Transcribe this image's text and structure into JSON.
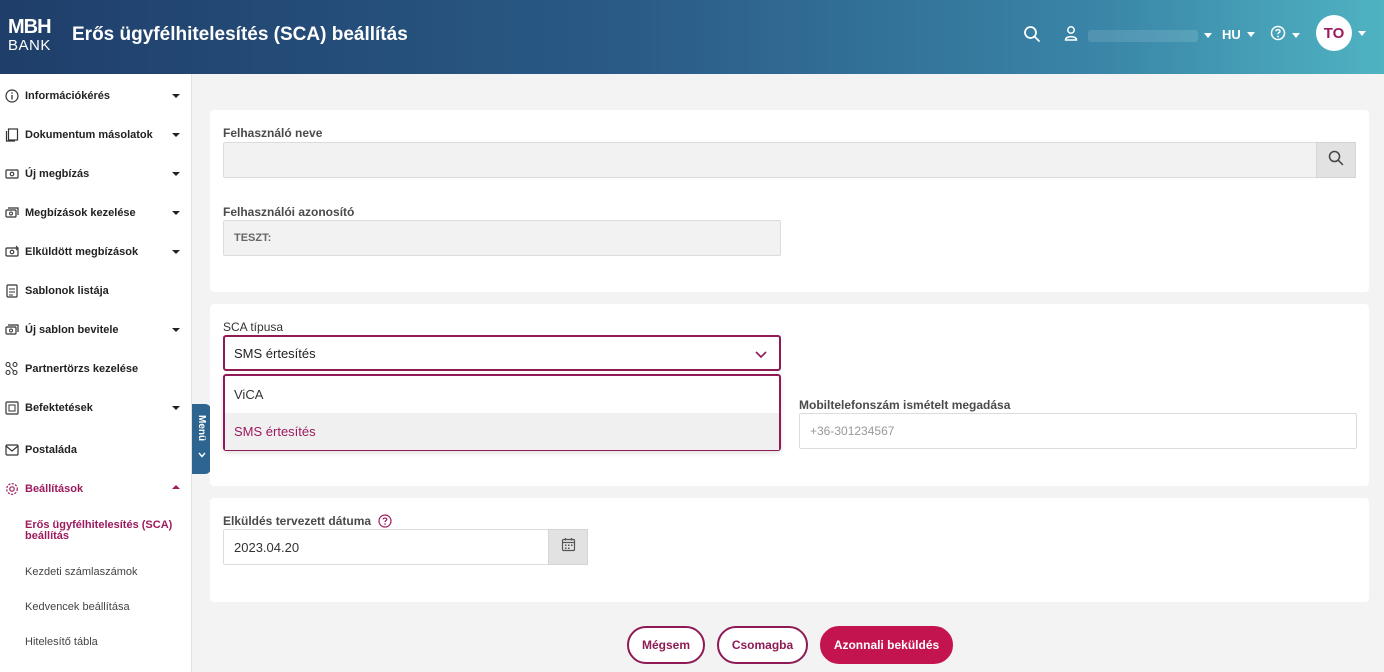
{
  "header": {
    "logo_line1": "MBH",
    "logo_line2": "BANK",
    "title": "Erős ügyfélhitelesítés (SCA) beállítás",
    "language": "HU",
    "avatar_initials": "TO"
  },
  "sidebar": {
    "items": [
      {
        "label": "Információkérés",
        "icon": "info-icon"
      },
      {
        "label": "Dokumentum másolatok",
        "icon": "document-copy-icon"
      },
      {
        "label": "Új megbízás",
        "icon": "new-order-icon"
      },
      {
        "label": "Megbízások kezelése",
        "icon": "manage-orders-icon"
      },
      {
        "label": "Elküldött megbízások",
        "icon": "sent-orders-icon"
      },
      {
        "label": "Sablonok listája",
        "icon": "template-list-icon"
      },
      {
        "label": "Új sablon bevitele",
        "icon": "new-template-icon"
      },
      {
        "label": "Partnertörzs kezelése",
        "icon": "partners-icon"
      },
      {
        "label": "Befektetések",
        "icon": "investments-icon"
      },
      {
        "label": "Postaláda",
        "icon": "mail-icon"
      },
      {
        "label": "Beállítások",
        "icon": "gear-icon"
      }
    ],
    "subitems": [
      {
        "label": "Erős ügyfélhitelesítés (SCA) beállítás"
      },
      {
        "label": "Kezdeti számlaszámok"
      },
      {
        "label": "Kedvencek beállítása"
      },
      {
        "label": "Hitelesítő tábla"
      }
    ],
    "menu_tab_label": "Menü"
  },
  "form": {
    "username_label": "Felhasználó neve",
    "userid_label": "Felhasználói azonosító",
    "userid_value": "TESZT:",
    "sca_label": "SCA típusa",
    "sca_selected": "SMS értesítés",
    "sca_options": [
      "ViCA",
      "SMS értesítés"
    ],
    "mobile_repeat_label": "Mobiltelefonszám ismételt megadása",
    "mobile_repeat_placeholder": "+36-301234567",
    "send_date_label": "Elküldés tervezett dátuma",
    "send_date_value": "2023.04.20"
  },
  "buttons": {
    "cancel": "Mégsem",
    "package": "Csomagba",
    "send_now": "Azonnali beküldés"
  },
  "colors": {
    "accent": "#9c1a5e",
    "primary_button": "#c4144f",
    "header_start": "#1f3e6a",
    "header_end": "#4fb3c2"
  }
}
